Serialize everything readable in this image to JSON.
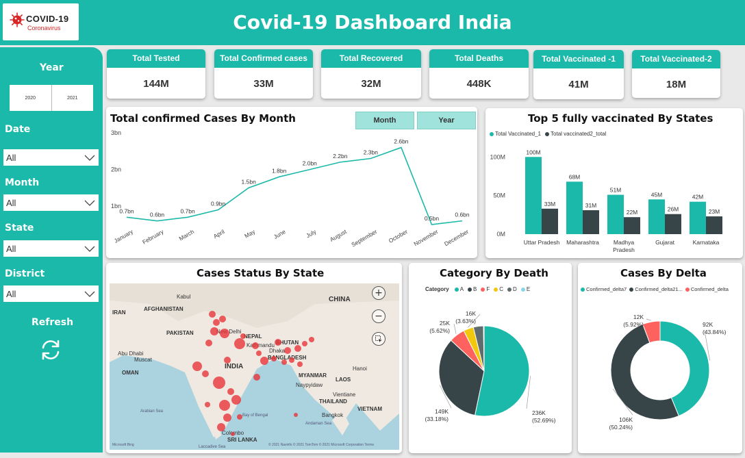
{
  "header": {
    "title": "Covid-19 Dashboard India",
    "logo_main": "COVID-19",
    "logo_sub": "Coronavirus",
    "logo_icon": "virus-icon"
  },
  "colors": {
    "teal": "#1bb9a9",
    "dark": "#374549",
    "red": "#fd625e",
    "yellow": "#f2c80f",
    "grey": "#5f6b6d",
    "light_blue": "#8ad4eb",
    "bubble": "#e8353a"
  },
  "sidebar": {
    "year_label": "Year",
    "years": [
      "2020",
      "2021"
    ],
    "date_label": "Date",
    "date_value": "All",
    "month_label": "Month",
    "month_value": "All",
    "state_label": "State",
    "state_value": "All",
    "district_label": "District",
    "district_value": "All",
    "refresh_label": "Refresh",
    "refresh_icon": "refresh-icon"
  },
  "kpis": [
    {
      "title": "Total Tested",
      "value": "144M"
    },
    {
      "title": "Total Confirmed cases",
      "value": "33M"
    },
    {
      "title": "Total Recovered",
      "value": "32M"
    },
    {
      "title": "Total Deaths",
      "value": "448K"
    },
    {
      "title": "Total Vaccinated -1",
      "value": "41M"
    },
    {
      "title": "Total Vaccinated-2",
      "value": "18M"
    }
  ],
  "monthly": {
    "title": "Total confirmed Cases By Month",
    "toggle_month": "Month",
    "toggle_year": "Year"
  },
  "vaccinated": {
    "title": "Top 5 fully vaccinated By States"
  },
  "map": {
    "title": "Cases Status By State",
    "attribution": "© 2021 Navinfo © 2021 TomTom © 2021 Microsoft Corporation Terms",
    "brand": "Microsoft Bing",
    "zoom_in": "+",
    "zoom_out": "−",
    "labels": {
      "china": "CHINA",
      "india": "INDIA",
      "pakistan": "PAKISTAN",
      "afghanistan": "AFGHANISTAN",
      "iran": "IRAN",
      "nepal": "NEPAL",
      "bhutan": "BHUTAN",
      "bangladesh": "BANGLADESH",
      "myanmar": "MYANMAR",
      "laos": "LAOS",
      "vietnam": "VIETNAM",
      "thailand": "THAILAND",
      "oman": "OMAN",
      "sri_lanka": "SRI LANKA",
      "kabul": "Kabul",
      "new_delhi": "New Delhi",
      "kathmandu": "Kathmandu",
      "muscat": "Muscat",
      "abu_dhabi": "Abu Dhabi",
      "dhaka": "Dhaka",
      "naypyidaw": "Naypyidaw",
      "hanoi": "Hanoi",
      "bangkok": "Bangkok",
      "vientiane": "Vientiane",
      "colombo": "Colombo",
      "arabian_sea": "Arabian Sea",
      "bay_of_bengal": "Bay of Bengal",
      "andaman_sea": "Andaman Sea",
      "laccadive_sea": "Laccadive Sea"
    }
  },
  "death": {
    "title": "Category By Death",
    "legend_label": "Category"
  },
  "delta": {
    "title": "Cases By Delta"
  },
  "chart_data": [
    {
      "type": "line",
      "title": "Total confirmed Cases By Month",
      "categories": [
        "January",
        "February",
        "March",
        "April",
        "May",
        "June",
        "July",
        "August",
        "September",
        "October",
        "November",
        "December"
      ],
      "values": [
        0.7,
        0.6,
        0.7,
        0.9,
        1.5,
        1.8,
        2.0,
        2.2,
        2.3,
        2.6,
        0.5,
        0.6
      ],
      "data_labels": [
        "0.7bn",
        "0.6bn",
        "0.7bn",
        "0.9bn",
        "1.5bn",
        "1.8bn",
        "2.0bn",
        "2.2bn",
        "2.3bn",
        "2.6bn",
        "0.5bn",
        "0.6bn"
      ],
      "yticks": [
        "1bn",
        "2bn",
        "3bn"
      ],
      "ytick_values": [
        1,
        2,
        3
      ],
      "ylim": [
        0.5,
        3
      ],
      "grid": false
    },
    {
      "type": "bar",
      "title": "Top 5 fully vaccinated By States",
      "categories": [
        "Uttar Pradesh",
        "Maharashtra",
        "Madhya Pradesh",
        "Gujarat",
        "Karnataka"
      ],
      "series": [
        {
          "name": "Total Vaccinated_1",
          "values": [
            100,
            68,
            51,
            45,
            42
          ],
          "labels": [
            "100M",
            "68M",
            "51M",
            "45M",
            "42M"
          ],
          "color": "#1bb9a9"
        },
        {
          "name": "Total vaccinated2_total",
          "values": [
            33,
            31,
            22,
            26,
            23
          ],
          "labels": [
            "33M",
            "31M",
            "22M",
            "26M",
            "23M"
          ],
          "color": "#374549"
        }
      ],
      "yticks": [
        "0M",
        "50M",
        "100M"
      ],
      "ytick_values": [
        0,
        50,
        100
      ],
      "ylim": [
        0,
        110
      ],
      "legend": "top-left"
    },
    {
      "type": "pie",
      "title": "Category By Death",
      "legend": "top",
      "slices": [
        {
          "name": "A",
          "value": 236,
          "label": "236K",
          "pct": "(52.69%)",
          "color": "#1bb9a9"
        },
        {
          "name": "B",
          "value": 149,
          "label": "149K",
          "pct": "(33.18%)",
          "color": "#374549"
        },
        {
          "name": "F",
          "value": 25,
          "label": "25K",
          "pct": "(5.62%)",
          "color": "#fd625e"
        },
        {
          "name": "C",
          "value": 16,
          "label": "16K",
          "pct": "(3.63%)",
          "color": "#f2c80f"
        },
        {
          "name": "D",
          "value": 16,
          "label": "",
          "pct": "",
          "color": "#5f6b6d"
        },
        {
          "name": "E",
          "value": 1,
          "label": "",
          "pct": "",
          "color": "#8ad4eb"
        }
      ]
    },
    {
      "type": "pie",
      "donut": true,
      "title": "Cases By Delta",
      "legend": "top",
      "slices": [
        {
          "name": "Confirmed_delta7",
          "value": 92,
          "label": "92K",
          "pct": "(43.84%)",
          "color": "#1bb9a9"
        },
        {
          "name": "Confirmed_delta21...",
          "value": 106,
          "label": "106K",
          "pct": "(50.24%)",
          "color": "#374549"
        },
        {
          "name": "Confirmed_delta",
          "value": 12,
          "label": "12K",
          "pct": "(5.92%)",
          "color": "#fd625e"
        }
      ]
    }
  ]
}
